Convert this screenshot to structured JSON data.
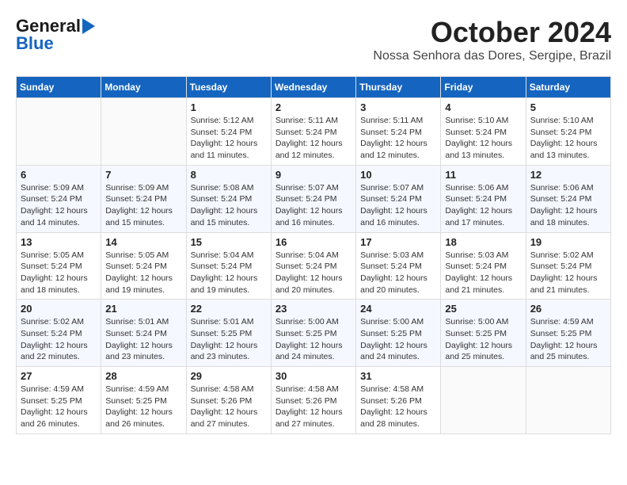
{
  "header": {
    "logo_line1": "General",
    "logo_line2": "Blue",
    "month": "October 2024",
    "location": "Nossa Senhora das Dores, Sergipe, Brazil"
  },
  "weekdays": [
    "Sunday",
    "Monday",
    "Tuesday",
    "Wednesday",
    "Thursday",
    "Friday",
    "Saturday"
  ],
  "weeks": [
    [
      {
        "day": "",
        "info": ""
      },
      {
        "day": "",
        "info": ""
      },
      {
        "day": "1",
        "info": "Sunrise: 5:12 AM\nSunset: 5:24 PM\nDaylight: 12 hours and 11 minutes."
      },
      {
        "day": "2",
        "info": "Sunrise: 5:11 AM\nSunset: 5:24 PM\nDaylight: 12 hours and 12 minutes."
      },
      {
        "day": "3",
        "info": "Sunrise: 5:11 AM\nSunset: 5:24 PM\nDaylight: 12 hours and 12 minutes."
      },
      {
        "day": "4",
        "info": "Sunrise: 5:10 AM\nSunset: 5:24 PM\nDaylight: 12 hours and 13 minutes."
      },
      {
        "day": "5",
        "info": "Sunrise: 5:10 AM\nSunset: 5:24 PM\nDaylight: 12 hours and 13 minutes."
      }
    ],
    [
      {
        "day": "6",
        "info": "Sunrise: 5:09 AM\nSunset: 5:24 PM\nDaylight: 12 hours and 14 minutes."
      },
      {
        "day": "7",
        "info": "Sunrise: 5:09 AM\nSunset: 5:24 PM\nDaylight: 12 hours and 15 minutes."
      },
      {
        "day": "8",
        "info": "Sunrise: 5:08 AM\nSunset: 5:24 PM\nDaylight: 12 hours and 15 minutes."
      },
      {
        "day": "9",
        "info": "Sunrise: 5:07 AM\nSunset: 5:24 PM\nDaylight: 12 hours and 16 minutes."
      },
      {
        "day": "10",
        "info": "Sunrise: 5:07 AM\nSunset: 5:24 PM\nDaylight: 12 hours and 16 minutes."
      },
      {
        "day": "11",
        "info": "Sunrise: 5:06 AM\nSunset: 5:24 PM\nDaylight: 12 hours and 17 minutes."
      },
      {
        "day": "12",
        "info": "Sunrise: 5:06 AM\nSunset: 5:24 PM\nDaylight: 12 hours and 18 minutes."
      }
    ],
    [
      {
        "day": "13",
        "info": "Sunrise: 5:05 AM\nSunset: 5:24 PM\nDaylight: 12 hours and 18 minutes."
      },
      {
        "day": "14",
        "info": "Sunrise: 5:05 AM\nSunset: 5:24 PM\nDaylight: 12 hours and 19 minutes."
      },
      {
        "day": "15",
        "info": "Sunrise: 5:04 AM\nSunset: 5:24 PM\nDaylight: 12 hours and 19 minutes."
      },
      {
        "day": "16",
        "info": "Sunrise: 5:04 AM\nSunset: 5:24 PM\nDaylight: 12 hours and 20 minutes."
      },
      {
        "day": "17",
        "info": "Sunrise: 5:03 AM\nSunset: 5:24 PM\nDaylight: 12 hours and 20 minutes."
      },
      {
        "day": "18",
        "info": "Sunrise: 5:03 AM\nSunset: 5:24 PM\nDaylight: 12 hours and 21 minutes."
      },
      {
        "day": "19",
        "info": "Sunrise: 5:02 AM\nSunset: 5:24 PM\nDaylight: 12 hours and 21 minutes."
      }
    ],
    [
      {
        "day": "20",
        "info": "Sunrise: 5:02 AM\nSunset: 5:24 PM\nDaylight: 12 hours and 22 minutes."
      },
      {
        "day": "21",
        "info": "Sunrise: 5:01 AM\nSunset: 5:24 PM\nDaylight: 12 hours and 23 minutes."
      },
      {
        "day": "22",
        "info": "Sunrise: 5:01 AM\nSunset: 5:25 PM\nDaylight: 12 hours and 23 minutes."
      },
      {
        "day": "23",
        "info": "Sunrise: 5:00 AM\nSunset: 5:25 PM\nDaylight: 12 hours and 24 minutes."
      },
      {
        "day": "24",
        "info": "Sunrise: 5:00 AM\nSunset: 5:25 PM\nDaylight: 12 hours and 24 minutes."
      },
      {
        "day": "25",
        "info": "Sunrise: 5:00 AM\nSunset: 5:25 PM\nDaylight: 12 hours and 25 minutes."
      },
      {
        "day": "26",
        "info": "Sunrise: 4:59 AM\nSunset: 5:25 PM\nDaylight: 12 hours and 25 minutes."
      }
    ],
    [
      {
        "day": "27",
        "info": "Sunrise: 4:59 AM\nSunset: 5:25 PM\nDaylight: 12 hours and 26 minutes."
      },
      {
        "day": "28",
        "info": "Sunrise: 4:59 AM\nSunset: 5:25 PM\nDaylight: 12 hours and 26 minutes."
      },
      {
        "day": "29",
        "info": "Sunrise: 4:58 AM\nSunset: 5:26 PM\nDaylight: 12 hours and 27 minutes."
      },
      {
        "day": "30",
        "info": "Sunrise: 4:58 AM\nSunset: 5:26 PM\nDaylight: 12 hours and 27 minutes."
      },
      {
        "day": "31",
        "info": "Sunrise: 4:58 AM\nSunset: 5:26 PM\nDaylight: 12 hours and 28 minutes."
      },
      {
        "day": "",
        "info": ""
      },
      {
        "day": "",
        "info": ""
      }
    ]
  ]
}
